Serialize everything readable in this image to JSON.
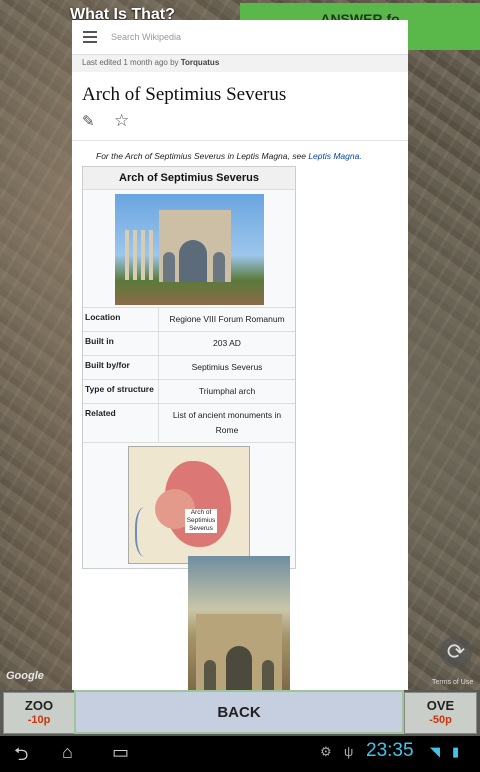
{
  "game": {
    "question_title": "What Is That?",
    "answer_button": "ANSWER fo",
    "zoom_label": "ZOO",
    "zoom_cost": "-10p",
    "move_label": "OVE",
    "move_cost": "-50p",
    "back_button": "BACK",
    "map_logo": "Google",
    "map_terms": "Terms of Use"
  },
  "wiki": {
    "search_placeholder": "Search Wikipedia",
    "last_edited_prefix": "Last edited 1 month ago by",
    "last_edited_user": "Torquatus",
    "title": "Arch of Septimius Severus",
    "hatnote_text": "For the Arch of Septimius Severus in Leptis Magna, see",
    "hatnote_link": "Leptis Magna",
    "infobox": {
      "title": "Arch of Septimius Severus",
      "rows": [
        {
          "key": "Location",
          "value": "Regione VIII Forum Romanum"
        },
        {
          "key": "Built in",
          "value": "203 AD"
        },
        {
          "key": "Built by/for",
          "value": "Septimius Severus"
        },
        {
          "key": "Type of structure",
          "value": "Triumphal arch"
        },
        {
          "key": "Related",
          "value": "List of ancient monuments in Rome"
        }
      ],
      "map_label": "Arch of Septimius Severus"
    }
  },
  "system": {
    "time": "23:35"
  }
}
